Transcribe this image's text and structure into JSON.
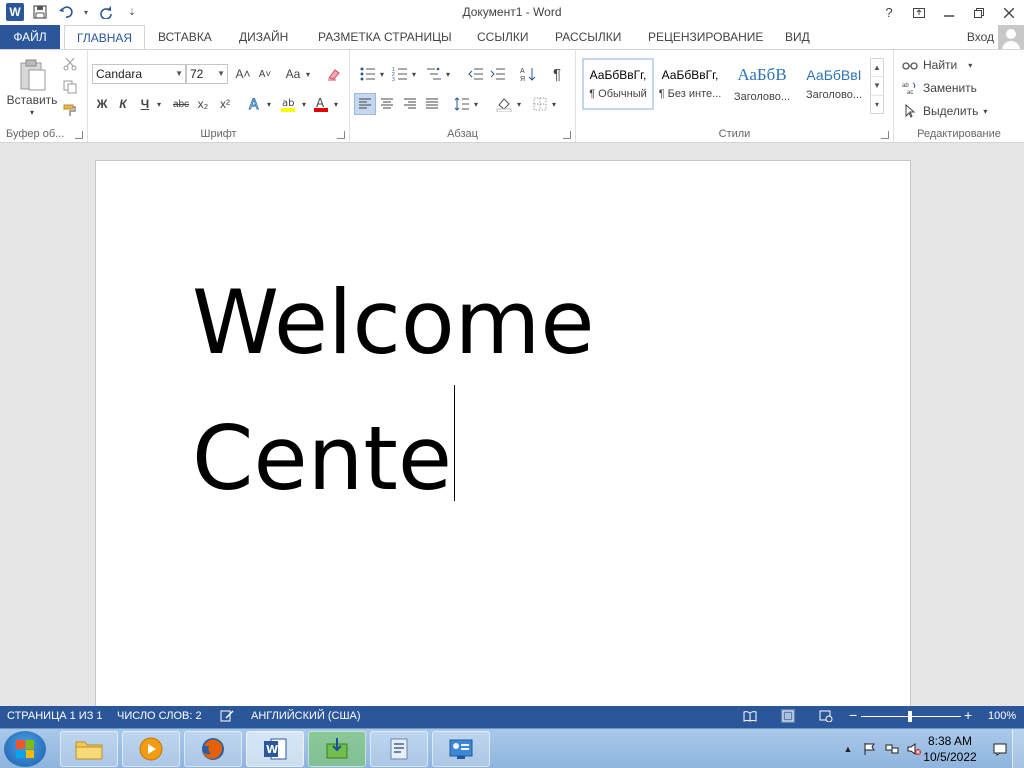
{
  "window": {
    "title": "Документ1 - Word"
  },
  "quick_access": {
    "icons": [
      "word-icon",
      "save-icon",
      "undo-icon",
      "redo-icon",
      "customize-icon"
    ]
  },
  "window_controls": {
    "help": "?",
    "options": "⇱",
    "minimize": "—",
    "restore": "❒",
    "close": "✕"
  },
  "tabs": [
    {
      "label": "ФАЙЛ",
      "active": false
    },
    {
      "label": "ГЛАВНАЯ",
      "active": true
    },
    {
      "label": "ВСТАВКА",
      "active": false
    },
    {
      "label": "ДИЗАЙН",
      "active": false
    },
    {
      "label": "РАЗМЕТКА СТРАНИЦЫ",
      "active": false
    },
    {
      "label": "ССЫЛКИ",
      "active": false
    },
    {
      "label": "РАССЫЛКИ",
      "active": false
    },
    {
      "label": "РЕЦЕНЗИРОВАНИЕ",
      "active": false
    },
    {
      "label": "ВИД",
      "active": false
    }
  ],
  "account": {
    "login_label": "Вход"
  },
  "ribbon": {
    "clipboard": {
      "paste_label": "Вставить",
      "group_label": "Буфер об..."
    },
    "font": {
      "font_name": "Candara",
      "font_size": "72",
      "bold": "Ж",
      "italic": "К",
      "underline": "Ч",
      "strikethrough": "abc",
      "subscript": "x₂",
      "superscript": "x²",
      "grow": "A˄",
      "shrink": "A˅",
      "change_case": "Aa",
      "group_label": "Шрифт"
    },
    "paragraph": {
      "show_marks": "¶",
      "group_label": "Абзац"
    },
    "styles": {
      "items": [
        {
          "sample": "АаБбВвГг,",
          "name": "¶ Обычный",
          "selected": true,
          "kind": "normal"
        },
        {
          "sample": "АаБбВвГг,",
          "name": "¶ Без инте...",
          "selected": false,
          "kind": "normal"
        },
        {
          "sample": "АаБбВ",
          "name": "Заголово...",
          "selected": false,
          "kind": "heading"
        },
        {
          "sample": "АаБбВвI",
          "name": "Заголово...",
          "selected": false,
          "kind": "heading2"
        }
      ],
      "group_label": "Стили"
    },
    "editing": {
      "find_label": "Найти",
      "replace_label": "Заменить",
      "select_label": "Выделить",
      "group_label": "Редактирование"
    }
  },
  "document": {
    "lines": [
      "Welcome",
      "Cente"
    ]
  },
  "statusbar": {
    "page": "СТРАНИЦА 1 ИЗ 1",
    "words": "ЧИСЛО СЛОВ: 2",
    "language": "АНГЛИЙСКИЙ (США)",
    "zoom": "100%",
    "zoom_level_percent": 100
  },
  "taskbar": {
    "apps": [
      "file-explorer-icon",
      "media-player-icon",
      "firefox-icon",
      "word-icon",
      "installer-icon",
      "document-app-icon",
      "control-panel-icon"
    ],
    "active_app": "word-icon"
  },
  "clock": {
    "time": "8:38 AM",
    "date": "10/5/2022"
  },
  "colors": {
    "accent": "#2b579a",
    "heading": "#2e74b5"
  }
}
